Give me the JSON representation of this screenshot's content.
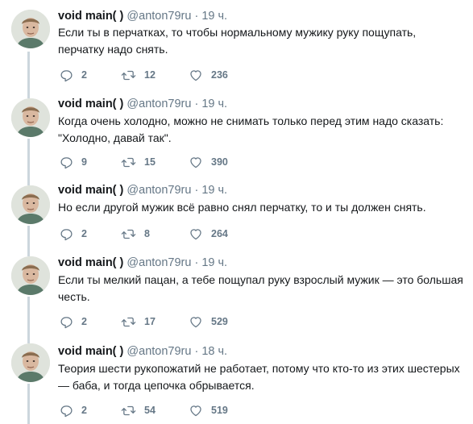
{
  "tweets": [
    {
      "name": "void main( )",
      "handle": "@anton79ru",
      "dot": "·",
      "time": "19 ч.",
      "text": "Если ты в перчатках, то чтобы нормальному мужику руку пощупать, перчатку надо снять.",
      "replies": "2",
      "retweets": "12",
      "likes": "236"
    },
    {
      "name": "void main( )",
      "handle": "@anton79ru",
      "dot": "·",
      "time": "19 ч.",
      "text": "Когда очень холодно, можно не снимать только перед этим надо сказать: \"Холодно, давай так\".",
      "replies": "9",
      "retweets": "15",
      "likes": "390"
    },
    {
      "name": "void main( )",
      "handle": "@anton79ru",
      "dot": "·",
      "time": "19 ч.",
      "text": "Но если другой мужик всё равно снял перчатку, то и ты должен снять.",
      "replies": "2",
      "retweets": "8",
      "likes": "264"
    },
    {
      "name": "void main( )",
      "handle": "@anton79ru",
      "dot": "·",
      "time": "19 ч.",
      "text": "Если ты мелкий пацан, а тебе пощупал руку взрослый мужик — это большая честь.",
      "replies": "2",
      "retweets": "17",
      "likes": "529"
    },
    {
      "name": "void main( )",
      "handle": "@anton79ru",
      "dot": "·",
      "time": "18 ч.",
      "text": "Теория шести рукопожатий не работает, потому что кто-то из этих шестерых — баба, и тогда цепочка обрывается.",
      "replies": "2",
      "retweets": "54",
      "likes": "519"
    }
  ],
  "icons": {
    "reply": "reply-icon",
    "retweet": "retweet-icon",
    "like": "heart-icon"
  },
  "colors": {
    "thread_line": "#ccd6dd",
    "muted": "#657786",
    "text": "#14171a"
  }
}
